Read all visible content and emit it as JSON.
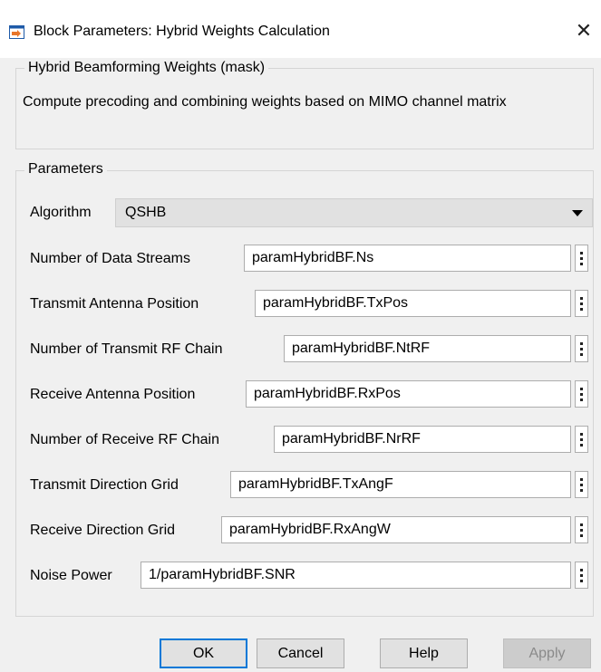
{
  "window": {
    "title": "Block Parameters: Hybrid Weights Calculation",
    "close_glyph": "✕"
  },
  "mask_group": {
    "legend": "Hybrid Beamforming Weights (mask)",
    "description": "Compute precoding and combining weights based on MIMO channel matrix"
  },
  "params_group": {
    "legend": "Parameters",
    "algorithm": {
      "label": "Algorithm",
      "selected": "QSHB"
    },
    "fields": [
      {
        "label": "Number of Data Streams",
        "value": "paramHybridBF.Ns"
      },
      {
        "label": "Transmit Antenna Position",
        "value": "paramHybridBF.TxPos"
      },
      {
        "label": "Number of Transmit RF Chain",
        "value": "paramHybridBF.NtRF"
      },
      {
        "label": "Receive Antenna Position",
        "value": "paramHybridBF.RxPos"
      },
      {
        "label": "Number of Receive RF Chain",
        "value": "paramHybridBF.NrRF"
      },
      {
        "label": "Transmit Direction Grid",
        "value": "paramHybridBF.TxAngF"
      },
      {
        "label": "Receive Direction Grid",
        "value": "paramHybridBF.RxAngW"
      },
      {
        "label": "Noise Power",
        "value": "1/paramHybridBF.SNR"
      }
    ]
  },
  "buttons": {
    "ok": "OK",
    "cancel": "Cancel",
    "help": "Help",
    "apply": "Apply"
  },
  "icons": {
    "app": "block-parameters-icon",
    "close": "close-icon",
    "dropdown": "chevron-down-icon",
    "more": "vertical-ellipsis-icon"
  },
  "colors": {
    "focus_border": "#0078d7",
    "dialog_bg": "#f0f0f0"
  }
}
